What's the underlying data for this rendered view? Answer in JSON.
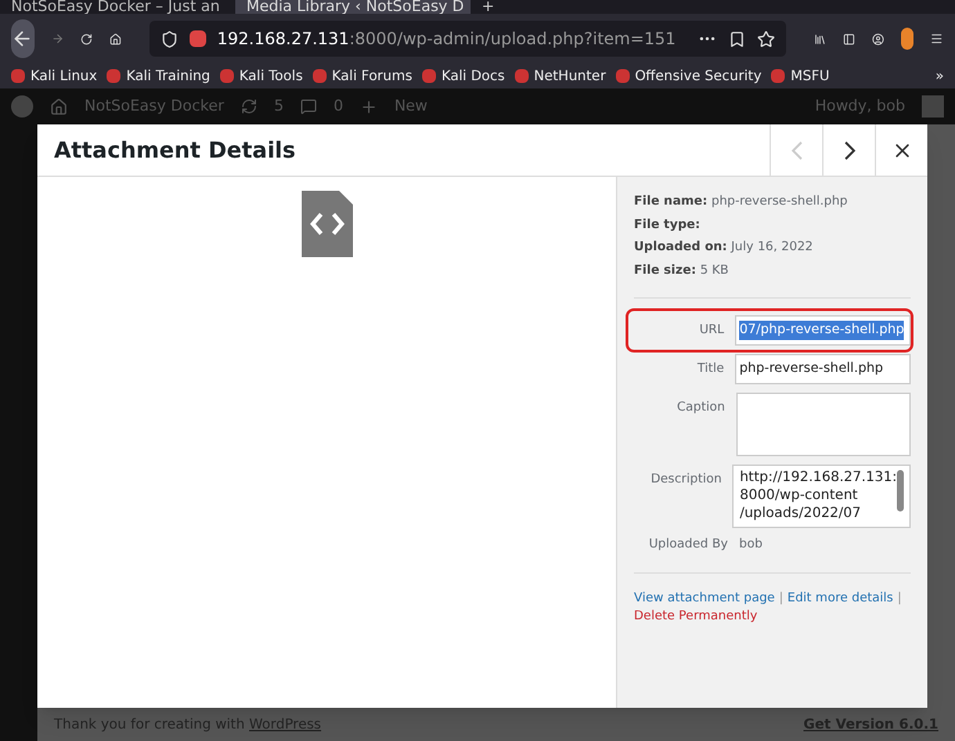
{
  "browser": {
    "tabs": [
      {
        "title": "NotSoEasy Docker – Just an",
        "selected": false
      },
      {
        "title": "Media Library ‹ NotSoEasy D",
        "selected": true
      }
    ],
    "new_tab": "+",
    "address": {
      "host": "192.168.27.131",
      "rest": ":8000/wp-admin/upload.php?item=151"
    },
    "bookmarks": [
      "Kali Linux",
      "Kali Training",
      "Kali Tools",
      "Kali Forums",
      "Kali Docs",
      "NetHunter",
      "Offensive Security",
      "MSFU"
    ],
    "more": "»"
  },
  "admin_bar": {
    "site": "NotSoEasy Docker",
    "updates": "5",
    "comments": "0",
    "new": "New",
    "howdy": "Howdy, bob"
  },
  "modal": {
    "title": "Attachment Details",
    "info": [
      {
        "label": "File name:",
        "value": "php-reverse-shell.php"
      },
      {
        "label": "File type:"
      },
      {
        "label": "Uploaded on:",
        "value": "July 16, 2022"
      },
      {
        "label": "File size:",
        "value": "5 KB"
      }
    ],
    "fields": [
      {
        "kind": "input",
        "label": "URL",
        "value": "07/php-reverse-shell.php",
        "selected": true
      },
      {
        "kind": "input",
        "label": "Title",
        "value": "php-reverse-shell.php",
        "selected": false
      },
      {
        "kind": "textarea",
        "label": "Caption",
        "selected": false
      },
      {
        "kind": "textarea",
        "label": "Description",
        "value": "http://192.168.27.131:\n8000/wp-content\n/uploads/2022/07",
        "selected": false
      },
      {
        "kind": "text",
        "label": "Uploaded By",
        "value": "bob",
        "selected": false
      }
    ],
    "links": [
      {
        "text": "View attachment page",
        "kind": "normal",
        "separator": "|"
      },
      {
        "text": "Edit more details",
        "kind": "normal",
        "separator": "|"
      },
      {
        "text": "Delete Permanently",
        "kind": "danger"
      }
    ]
  },
  "footer": {
    "thanks": "Thank you for creating with",
    "link": "WordPress",
    "version": "Get Version 6.0.1"
  }
}
